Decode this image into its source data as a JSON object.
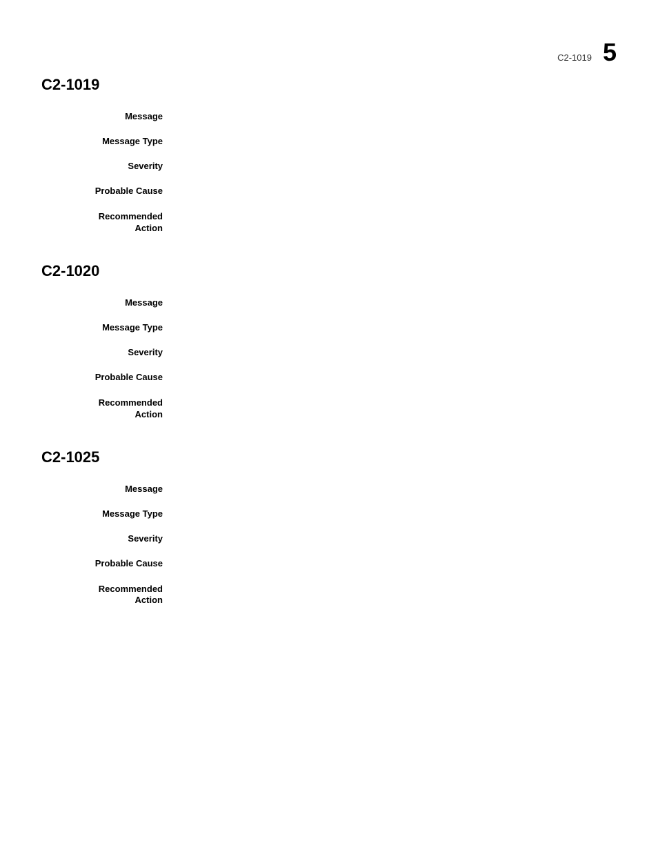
{
  "header": {
    "code": "C2-1019",
    "page_number": "5"
  },
  "sections": [
    {
      "id": "c2-1019",
      "title": "C2-1019",
      "fields": [
        {
          "label": "Message",
          "value": ""
        },
        {
          "label": "Message Type",
          "value": ""
        },
        {
          "label": "Severity",
          "value": ""
        },
        {
          "label": "Probable Cause",
          "value": ""
        },
        {
          "label": "Recommended\nAction",
          "value": "",
          "multiline_label": true
        }
      ]
    },
    {
      "id": "c2-1020",
      "title": "C2-1020",
      "fields": [
        {
          "label": "Message",
          "value": ""
        },
        {
          "label": "Message Type",
          "value": ""
        },
        {
          "label": "Severity",
          "value": ""
        },
        {
          "label": "Probable Cause",
          "value": ""
        },
        {
          "label": "Recommended\nAction",
          "value": "",
          "multiline_label": true
        }
      ]
    },
    {
      "id": "c2-1025",
      "title": "C2-1025",
      "fields": [
        {
          "label": "Message",
          "value": ""
        },
        {
          "label": "Message Type",
          "value": ""
        },
        {
          "label": "Severity",
          "value": ""
        },
        {
          "label": "Probable Cause",
          "value": ""
        },
        {
          "label": "Recommended\nAction",
          "value": "",
          "multiline_label": true
        }
      ]
    }
  ]
}
